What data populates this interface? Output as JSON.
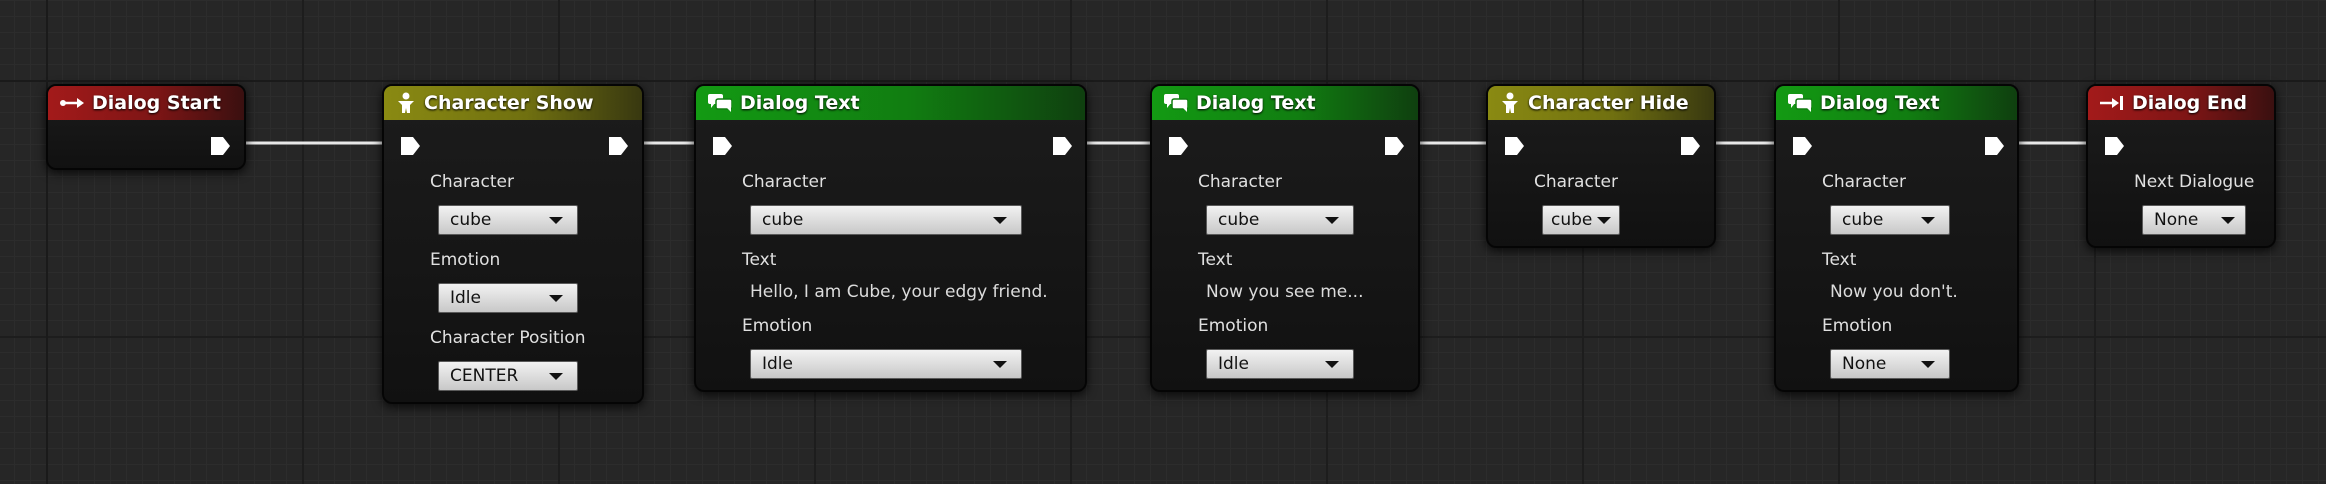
{
  "nodes": {
    "dialog_start": {
      "title": "Dialog Start",
      "icon": "flow-start-icon"
    },
    "character_show": {
      "title": "Character Show",
      "icon": "character-icon",
      "character_label": "Character",
      "character_value": "cube",
      "emotion_label": "Emotion",
      "emotion_value": "Idle",
      "position_label": "Character Position",
      "position_value": "CENTER"
    },
    "dialog_text_1": {
      "title": "Dialog Text",
      "icon": "speech-bubbles-icon",
      "character_label": "Character",
      "character_value": "cube",
      "text_label": "Text",
      "text_value": "Hello, I am Cube, your edgy friend.",
      "emotion_label": "Emotion",
      "emotion_value": "Idle"
    },
    "dialog_text_2": {
      "title": "Dialog Text",
      "icon": "speech-bubbles-icon",
      "character_label": "Character",
      "character_value": "cube",
      "text_label": "Text",
      "text_value": "Now you see me...",
      "emotion_label": "Emotion",
      "emotion_value": "Idle"
    },
    "character_hide": {
      "title": "Character Hide",
      "icon": "character-icon",
      "character_label": "Character",
      "character_value": "cube"
    },
    "dialog_text_3": {
      "title": "Dialog Text",
      "icon": "speech-bubbles-icon",
      "character_label": "Character",
      "character_value": "cube",
      "text_label": "Text",
      "text_value": "Now you don't.",
      "emotion_label": "Emotion",
      "emotion_value": "None"
    },
    "dialog_end": {
      "title": "Dialog End",
      "icon": "flow-end-icon",
      "next_label": "Next Dialogue",
      "next_value": "None"
    }
  },
  "colors": {
    "background": "#262626",
    "header_red": "#a31a1a",
    "header_yellow": "#8a8a12",
    "header_green": "#139a13",
    "wire": "#e8e8e8"
  }
}
